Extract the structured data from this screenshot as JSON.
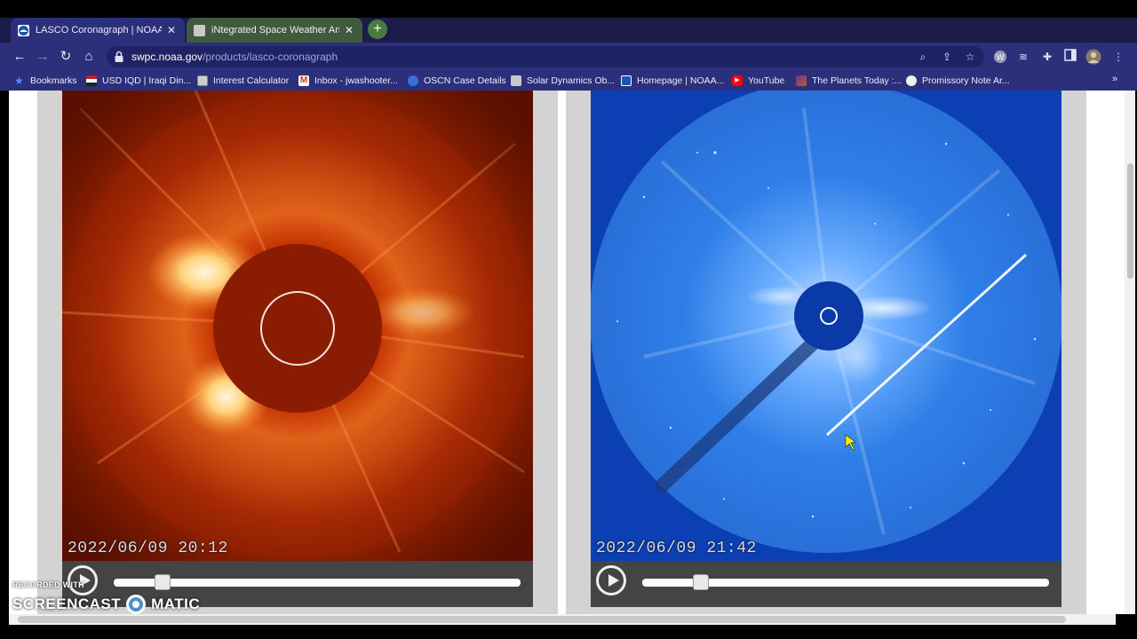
{
  "browser": {
    "tabs": [
      {
        "title": "LASCO Coronagraph | NOAA / N",
        "favicon": "noaa-icon",
        "active": true
      },
      {
        "title": "iNtegrated Space Weather Analy",
        "favicon": "satellite-icon",
        "active": false
      }
    ],
    "new_tab_label": "+",
    "address": {
      "domain": "swpc.noaa.gov",
      "path": "/products/lasco-coronagraph"
    },
    "bookmarks": [
      {
        "label": "Bookmarks",
        "icon": "star-icon"
      },
      {
        "label": "USD IQD | Iraqi Din...",
        "icon": "flag-icon"
      },
      {
        "label": "Interest Calculator",
        "icon": "calculator-icon"
      },
      {
        "label": "Inbox - jwashooter...",
        "icon": "gmail-icon"
      },
      {
        "label": "OSCN Case Details",
        "icon": "scales-icon"
      },
      {
        "label": "Solar Dynamics Ob...",
        "icon": "satellite-icon"
      },
      {
        "label": "Homepage | NOAA...",
        "icon": "noaa-icon"
      },
      {
        "label": "YouTube",
        "icon": "youtube-icon"
      },
      {
        "label": "The Planets Today :...",
        "icon": "planet-icon"
      },
      {
        "label": "Promissory Note Ar...",
        "icon": "document-icon"
      }
    ],
    "more_bookmarks": "»"
  },
  "players": [
    {
      "timestamp": "2022/06/09  20:12",
      "progress": 0.12,
      "theme": "red"
    },
    {
      "timestamp": "2022/06/09  21:42",
      "progress": 0.145,
      "theme": "blue"
    }
  ],
  "watermark": {
    "line1": "RECORDED WITH",
    "left": "SCREENCAST",
    "right": "MATIC"
  },
  "colors": {
    "frame": "#1b1c4a",
    "toolbar": "#2c2f7a",
    "red_sun": "#c83a05",
    "blue_sky": "#0b3fb3"
  }
}
